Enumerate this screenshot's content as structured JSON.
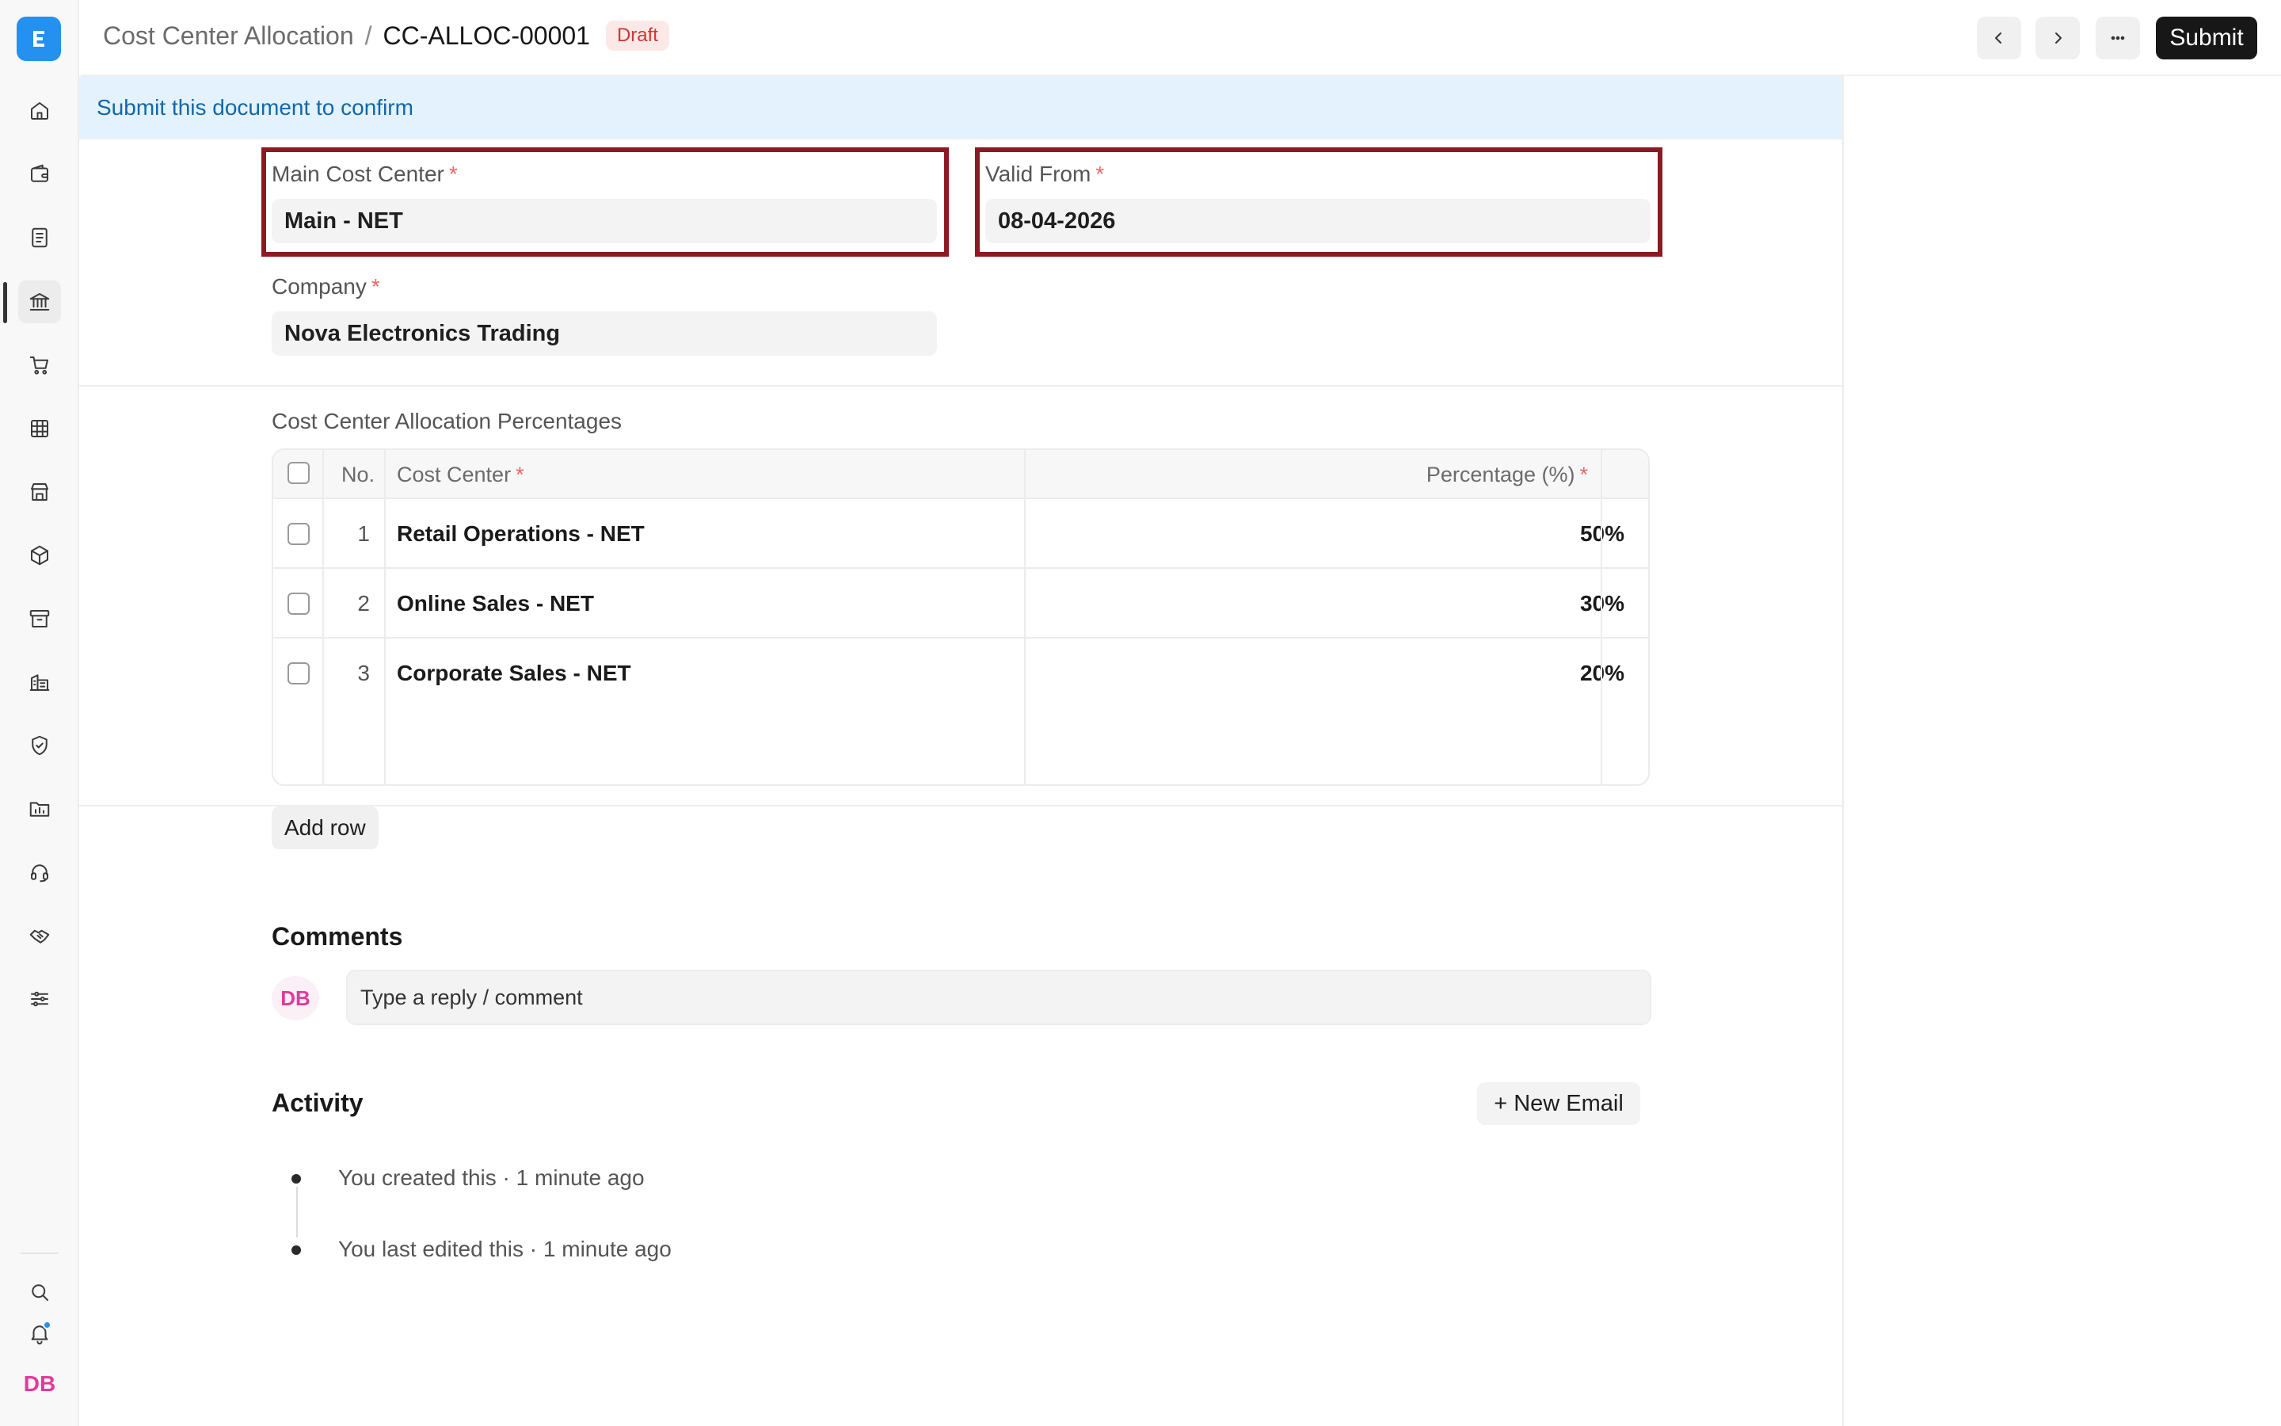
{
  "header": {
    "breadcrumb_parent": "Cost Center Allocation",
    "breadcrumb_separator": "/",
    "doc_name": "CC-ALLOC-00001",
    "status": "Draft",
    "submit_label": "Submit"
  },
  "banner": {
    "text": "Submit this document to confirm"
  },
  "form": {
    "main_cost_center": {
      "label": "Main Cost Center",
      "value": "Main - NET"
    },
    "valid_from": {
      "label": "Valid From",
      "value": "08-04-2026"
    },
    "company": {
      "label": "Company",
      "value": "Nova Electronics Trading"
    },
    "required_mark": "*"
  },
  "allocation_table": {
    "title": "Cost Center Allocation Percentages",
    "columns": {
      "no": "No.",
      "cost_center": "Cost Center",
      "percentage": "Percentage (%)"
    },
    "rows": [
      {
        "no": "1",
        "cost_center": "Retail Operations - NET",
        "percentage": "50%"
      },
      {
        "no": "2",
        "cost_center": "Online Sales - NET",
        "percentage": "30%"
      },
      {
        "no": "3",
        "cost_center": "Corporate Sales - NET",
        "percentage": "20%"
      }
    ],
    "add_row_label": "Add row"
  },
  "comments": {
    "heading": "Comments",
    "avatar_initials": "DB",
    "placeholder": "Type a reply / comment"
  },
  "activity": {
    "heading": "Activity",
    "new_email_label": "+ New Email",
    "items": [
      {
        "text": "You created this · 1 minute ago"
      },
      {
        "text": "You last edited this · 1 minute ago"
      }
    ]
  },
  "sidebar": {
    "logo_letter": "E",
    "user_initials": "DB",
    "icons": [
      "home-icon",
      "wallet-icon",
      "document-icon",
      "bank-icon",
      "cart-icon",
      "table-icon",
      "store-icon",
      "package-icon",
      "archive-icon",
      "building-icon",
      "shield-icon",
      "folder-chart-icon",
      "headset-icon",
      "handshake-icon",
      "sliders-icon",
      "search-icon",
      "bell-icon"
    ]
  },
  "colors": {
    "accent": "#2490ef",
    "highlight_border": "#8b1a22",
    "draft_badge_bg": "#fde8e8",
    "draft_badge_text": "#d03636",
    "banner_bg": "#e4f2fd",
    "avatar_pink": "#e03a9c"
  }
}
